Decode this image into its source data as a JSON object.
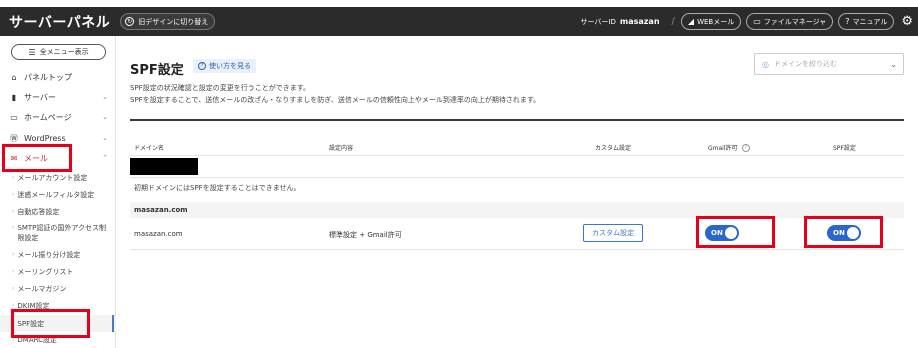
{
  "header": {
    "brand": "サーバーパネル",
    "old_design": "旧デザインに切り替え",
    "server_id_label": "サーバーID",
    "server_id_value": "masazan",
    "webmail": "WEBメール",
    "file_manager": "ファイルマネージャ",
    "manual": "マニュアル"
  },
  "sidebar": {
    "all_menu": "全メニュー表示",
    "nav": [
      {
        "label": "パネルトップ",
        "icon": "home-icon"
      },
      {
        "label": "サーバー",
        "icon": "server-icon"
      },
      {
        "label": "ホームページ",
        "icon": "monitor-icon"
      },
      {
        "label": "WordPress",
        "icon": "wordpress-icon"
      },
      {
        "label": "メール",
        "icon": "mail-icon"
      }
    ],
    "sub": [
      "メールアカウント設定",
      "迷惑メールフィルタ設定",
      "自動応答設定",
      "SMTP認証の国外アクセス制限設定",
      "メール振り分け設定",
      "メーリングリスト",
      "メールマガジン",
      "DKIM設定",
      "SPF設定",
      "DMARC設定"
    ]
  },
  "main": {
    "title": "SPF設定",
    "howto": "使い方を見る",
    "domain_filter_placeholder": "ドメインを絞り込む",
    "desc1": "SPF設定の状況確認と設定の変更を行うことができます。",
    "desc2": "SPFを設定することで、送信メールの改ざん・なりすましを防ぎ、送信メールの信頼性向上やメール到達率の向上が期待されます。",
    "columns": {
      "domain": "ドメイン名",
      "content": "設定内容",
      "custom": "カスタム設定",
      "gmail": "Gmail許可",
      "spf": "SPF設定"
    },
    "initial_note": "初期ドメインにはSPFを設定することはできません。",
    "group_label": "masazan.com",
    "row": {
      "domain": "masazan.com",
      "content": "標準設定 + Gmail許可",
      "custom_button": "カスタム設定",
      "gmail_toggle": "ON",
      "spf_toggle": "ON"
    }
  },
  "colors": {
    "header_bg": "#2b2b2b",
    "accent_blue": "#2a66cc",
    "highlight_red": "#e6001a"
  }
}
